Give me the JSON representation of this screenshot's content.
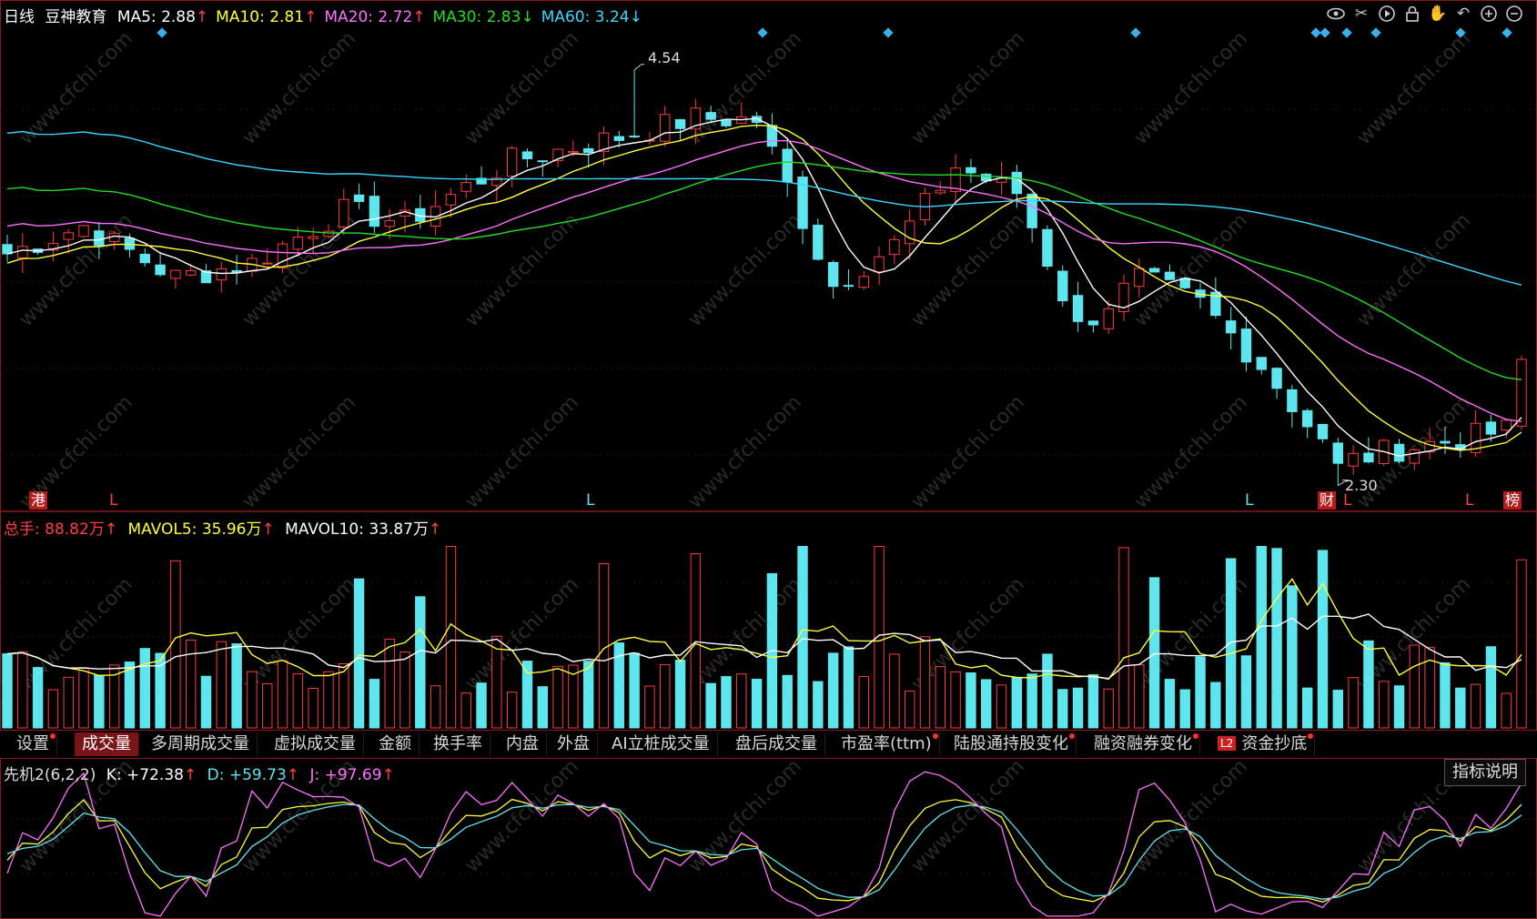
{
  "header": {
    "period": "日线",
    "stock_name": "豆神教育",
    "ma": [
      {
        "label": "MA5:",
        "value": "2.88",
        "arrow": "↑",
        "color": "#ffffff",
        "arrow_color": "#ff4040"
      },
      {
        "label": "MA10:",
        "value": "2.81",
        "arrow": "↑",
        "color": "#ffff3c",
        "arrow_color": "#ff4040"
      },
      {
        "label": "MA20:",
        "value": "2.72",
        "arrow": "↑",
        "color": "#ff70ff",
        "arrow_color": "#ff4040"
      },
      {
        "label": "MA30:",
        "value": "2.83",
        "arrow": "↓",
        "color": "#22dd22",
        "arrow_color": "#22dd22"
      },
      {
        "label": "MA60:",
        "value": "3.24",
        "arrow": "↓",
        "color": "#3ad7ff",
        "arrow_color": "#3ad7ff"
      }
    ]
  },
  "toolbar_icons": [
    "eye-icon",
    "scissors-icon",
    "play-icon",
    "lock-icon",
    "hand-icon",
    "undo-icon",
    "zoom-in-icon",
    "zoom-out-icon"
  ],
  "annotations": {
    "high_label": "4.54",
    "low_label": "2.30",
    "badge_gang": "港",
    "badge_cai": "财",
    "badge_bang": "榜",
    "l_marker": "L"
  },
  "volume_header": {
    "total_label": "总手:",
    "total_value": "88.82万",
    "total_arrow": "↑",
    "mavol5_label": "MAVOL5:",
    "mavol5_value": "35.96万",
    "mavol5_arrow": "↑",
    "mavol10_label": "MAVOL10:",
    "mavol10_value": "33.87万",
    "mavol10_arrow": "↑"
  },
  "tabs": [
    {
      "label": "设置",
      "dot": true
    },
    {
      "label": "成交量",
      "dot": false,
      "active": true
    },
    {
      "label": "多周期成交量",
      "dot": false
    },
    {
      "label": "虚拟成交量",
      "dot": false
    },
    {
      "label": "金额",
      "dot": false
    },
    {
      "label": "换手率",
      "dot": false
    },
    {
      "label": "内盘",
      "dot": false
    },
    {
      "label": "外盘",
      "dot": false
    },
    {
      "label": "AI立桩成交量",
      "dot": false
    },
    {
      "label": "盘后成交量",
      "dot": false
    },
    {
      "label": "市盈率(ttm)",
      "dot": true
    },
    {
      "label": "陆股通持股变化",
      "dot": true
    },
    {
      "label": "融资融券变化",
      "dot": true
    },
    {
      "label": "资金抄底",
      "dot": true,
      "badge": "L2"
    }
  ],
  "kdj_header": {
    "name": "先机2(6,2,2)",
    "k_label": "K:",
    "k_value": "+72.38",
    "k_arrow": "↑",
    "d_label": "D:",
    "d_value": "+59.73",
    "d_arrow": "↑",
    "j_label": "J:",
    "j_value": "+97.69",
    "j_arrow": "↑"
  },
  "help_button": "指标说明",
  "colors": {
    "up": "#ff3b3b",
    "down": "#5ee6ee",
    "ma5": "#ffffff",
    "ma10": "#ffff3c",
    "ma20": "#ff70ff",
    "ma30": "#22dd22",
    "ma60": "#3ad7ff",
    "border": "#8a1b1b"
  },
  "chart_data": {
    "type": "candlestick",
    "ylim": [
      2.22,
      4.72
    ],
    "count": 100,
    "key_points": [
      {
        "i": 0,
        "close": 3.55
      },
      {
        "i": 5,
        "close": 3.7
      },
      {
        "i": 11,
        "close": 3.42
      },
      {
        "i": 16,
        "close": 3.5
      },
      {
        "i": 22,
        "close": 3.78
      },
      {
        "i": 26,
        "close": 3.72
      },
      {
        "i": 33,
        "close": 4.05
      },
      {
        "i": 40,
        "close": 4.18
      },
      {
        "i": 45,
        "close": 4.28
      },
      {
        "i": 49,
        "close": 4.27
      },
      {
        "i": 54,
        "close": 3.38
      },
      {
        "i": 58,
        "close": 3.6
      },
      {
        "i": 62,
        "close": 4.02
      },
      {
        "i": 66,
        "close": 3.88
      },
      {
        "i": 70,
        "close": 3.15
      },
      {
        "i": 74,
        "close": 3.42
      },
      {
        "i": 78,
        "close": 3.28
      },
      {
        "i": 82,
        "close": 2.95
      },
      {
        "i": 87,
        "close": 2.42
      },
      {
        "i": 91,
        "close": 2.5
      },
      {
        "i": 95,
        "close": 2.55
      },
      {
        "i": 98,
        "close": 2.6
      },
      {
        "i": 99,
        "close": 2.98
      }
    ],
    "high_marker": {
      "value": 4.54,
      "index": 41
    },
    "low_marker": {
      "value": 2.3,
      "index": 87
    },
    "volume_ylim": [
      0,
      100
    ],
    "kdj_ylim": [
      0,
      100
    ]
  }
}
